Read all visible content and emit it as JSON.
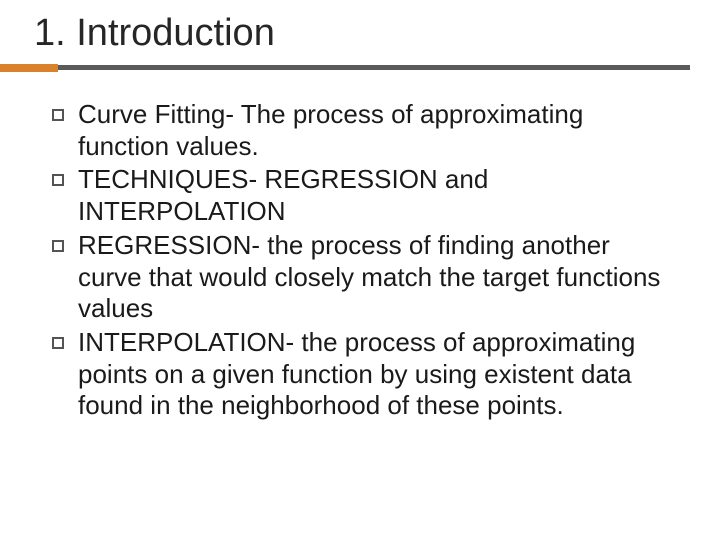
{
  "slide": {
    "title": "1. Introduction",
    "bullets": [
      "Curve Fitting- The process of approximating function values.",
      "TECHNIQUES- REGRESSION and INTERPOLATION",
      "REGRESSION- the process of finding another curve that would closely match the target functions values",
      "INTERPOLATION- the process of approximating points on a given function by using existent data found in the neighborhood of these points."
    ]
  }
}
